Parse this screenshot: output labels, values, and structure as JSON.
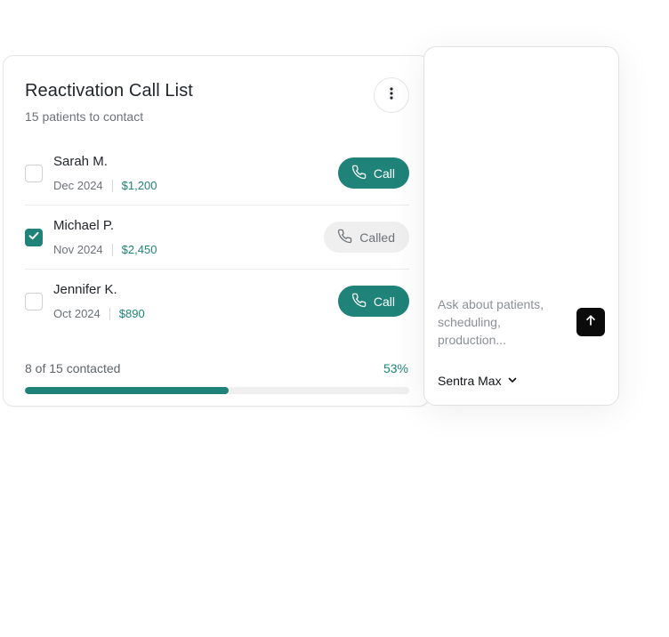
{
  "call_list": {
    "title": "Reactivation Call List",
    "subtitle": "15 patients to contact",
    "patients": [
      {
        "name": "Sarah M.",
        "date": "Dec 2024",
        "amount": "$1,200",
        "checked": false,
        "button_label": "Call",
        "button_state": "call"
      },
      {
        "name": "Michael P.",
        "date": "Nov 2024",
        "amount": "$2,450",
        "checked": true,
        "button_label": "Called",
        "button_state": "called"
      },
      {
        "name": "Jennifer K.",
        "date": "Oct 2024",
        "amount": "$890",
        "checked": false,
        "button_label": "Call",
        "button_state": "call"
      }
    ],
    "progress": {
      "label": "8 of 15 contacted",
      "percent_label": "53%",
      "percent": 53
    }
  },
  "chat": {
    "input_placeholder": "Ask about patients, scheduling, production...",
    "model_label": "Sentra Max"
  },
  "colors": {
    "accent": "#1f8379",
    "called_bg": "#efefef",
    "send_button": "#0b0b0c"
  },
  "icons": {
    "more": "more-vertical-icon",
    "phone": "phone-icon",
    "check": "check-icon",
    "send": "arrow-up-icon",
    "chevron": "chevron-down-icon"
  }
}
